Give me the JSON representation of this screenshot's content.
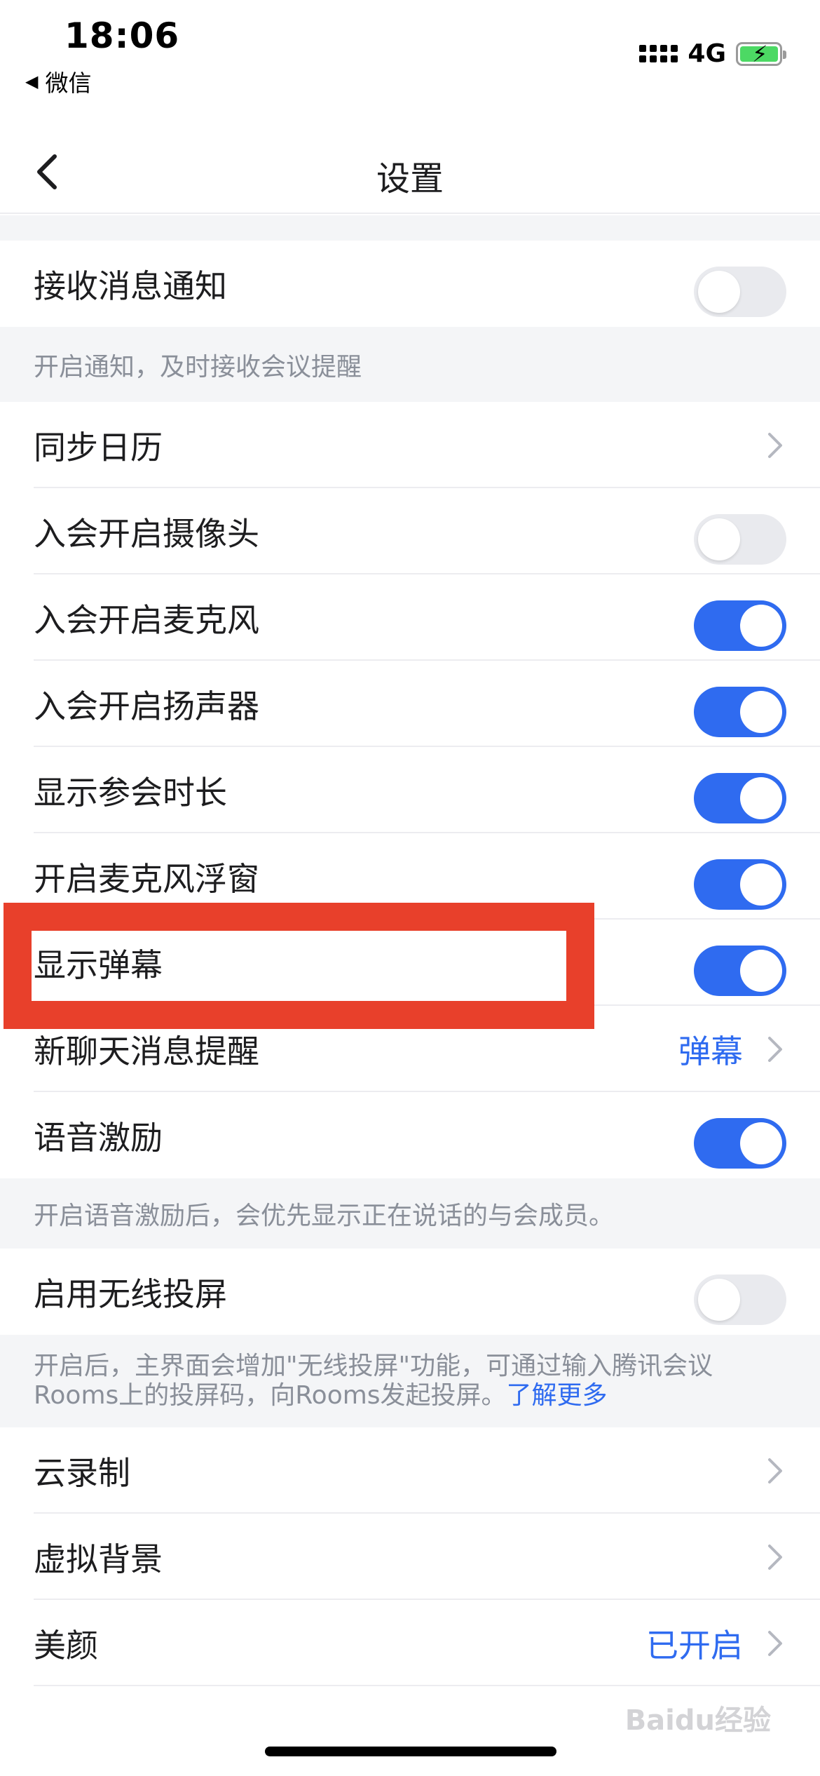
{
  "status_bar": {
    "time": "18:06",
    "back_app": "微信",
    "network": "4G",
    "battery_charging": true
  },
  "nav": {
    "title": "设置",
    "back_icon": "chevron-left-icon"
  },
  "settings": {
    "receive_notifications": {
      "label": "接收消息通知",
      "enabled": false
    },
    "notifications_note": "开启通知，及时接收会议提醒",
    "sync_calendar": {
      "label": "同步日历"
    },
    "camera_on_join": {
      "label": "入会开启摄像头",
      "enabled": false
    },
    "mic_on_join": {
      "label": "入会开启麦克风",
      "enabled": true
    },
    "speaker_on_join": {
      "label": "入会开启扬声器",
      "enabled": true
    },
    "show_duration": {
      "label": "显示参会时长",
      "enabled": true
    },
    "mic_float": {
      "label": "开启麦克风浮窗",
      "enabled": true
    },
    "show_danmaku": {
      "label": "显示弹幕",
      "enabled": true
    },
    "new_chat_alert": {
      "label": "新聊天消息提醒",
      "value": "弹幕"
    },
    "voice_motivation": {
      "label": "语音激励",
      "enabled": true
    },
    "voice_note": "开启语音激励后，会优先显示正在说话的与会成员。",
    "wireless_cast": {
      "label": "启用无线投屏",
      "enabled": false
    },
    "cast_note_line1": "开启后，主界面会增加\"无线投屏\"功能，可通过输入腾讯会议",
    "cast_note_line2": "Rooms上的投屏码，向Rooms发起投屏。",
    "cast_note_link": "了解更多",
    "cloud_record": {
      "label": "云录制"
    },
    "virtual_bg": {
      "label": "虚拟背景"
    },
    "beauty": {
      "label": "美颜",
      "value": "已开启"
    }
  },
  "highlight_color": "#e8402b",
  "accent_color": "#2f6bf0",
  "watermark": "Baidu经验"
}
